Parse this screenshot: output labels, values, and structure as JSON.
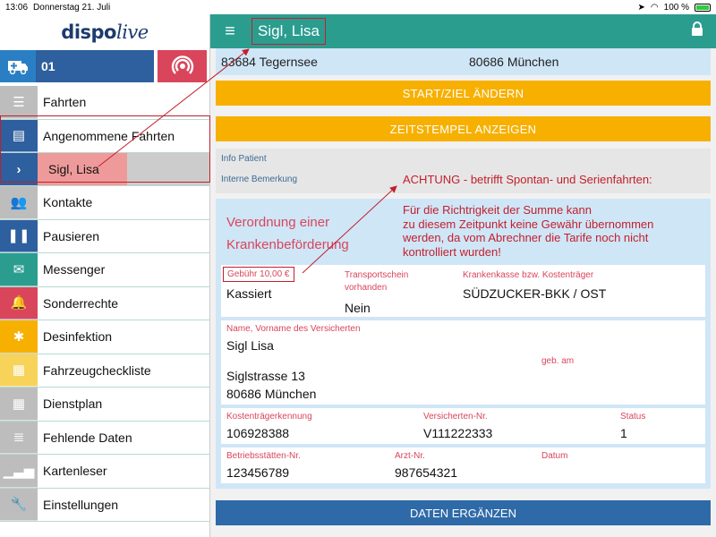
{
  "status": {
    "time": "13:06",
    "date": "Donnerstag 21. Juli",
    "battery": "100 %"
  },
  "sidebar": {
    "logo_main": "dispo",
    "logo_live": "live",
    "vehicle": "01",
    "items": [
      {
        "label": "Fahrten",
        "color": "#bdbdbd",
        "icon": "list-icon",
        "glyph": "☰"
      },
      {
        "label": "Angenommene Fahrten",
        "color": "#2e5f9e",
        "icon": "id-card-icon",
        "glyph": "▤"
      },
      {
        "label": "Kontakte",
        "color": "#bdbdbd",
        "icon": "people-icon",
        "glyph": "👥"
      },
      {
        "label": "Pausieren",
        "color": "#2e5f9e",
        "icon": "pause-icon",
        "glyph": "❚❚"
      },
      {
        "label": "Messenger",
        "color": "#2a9d8f",
        "icon": "envelope-icon",
        "glyph": "✉"
      },
      {
        "label": "Sonderrechte",
        "color": "#d9455b",
        "icon": "bell-icon",
        "glyph": "🔔"
      },
      {
        "label": "Desinfektion",
        "color": "#f7b000",
        "icon": "bug-icon",
        "glyph": "✱"
      },
      {
        "label": "Fahrzeugchecklistе",
        "color": "#f7d35a",
        "icon": "checklist-icon",
        "glyph": "▦"
      },
      {
        "label": "Dienstplan",
        "color": "#bdbdbd",
        "icon": "schedule-icon",
        "glyph": "▦"
      },
      {
        "label": "Fehlende Daten",
        "color": "#bdbdbd",
        "icon": "database-icon",
        "glyph": "≣"
      },
      {
        "label": "Kartenleser",
        "color": "#bdbdbd",
        "icon": "signal-bars-icon",
        "glyph": "▁▃▅"
      },
      {
        "label": "Einstellungen",
        "color": "#bdbdbd",
        "icon": "wrench-icon",
        "glyph": "🔧"
      }
    ],
    "subitem": "Sigl, Lisa"
  },
  "header": {
    "title": "Sigl, Lisa"
  },
  "address": {
    "from": "83684 Tegernsee",
    "to": "80686 München"
  },
  "buttons": {
    "start_ziel": "START/ZIEL ÄNDERN",
    "zeitstempel": "ZEITSTEMPEL ANZEIGEN",
    "daten": "DATEN ERGÄNZEN"
  },
  "info": {
    "patient": "Info Patient",
    "bemerkung": "Interne Bemerkung"
  },
  "warning": {
    "line1": "ACHTUNG - betrifft Spontan- und Serienfahrten:",
    "line2": "Für die Richtrigkeit der Summe kann",
    "line3": "zu diesem Zeitpunkt keine Gewähr übernommen",
    "line4": "werden, da vom Abrechner die Tarife noch nicht",
    "line5": "kontrolliert wurden!"
  },
  "card": {
    "title1": "Verordnung einer",
    "title2": "Krankenbeförderung",
    "fee_label": "Gebühr 10,00 €",
    "fee_value": "Kassiert",
    "transport_label1": "Transportschein",
    "transport_label2": "vorhanden",
    "transport_value": "Nein",
    "kasse_label": "Krankenkasse bzw. Kostenträger",
    "kasse_value": "SÜDZUCKER-BKK / OST",
    "name_label": "Name, Vorname des Versicherten",
    "name_value": "Sigl Lisa",
    "geb_label": "geb. am",
    "street": "Siglstrasse 13",
    "city": "80686 München",
    "kt_label": "Kostenträgerkennung",
    "kt_value": "106928388",
    "vnr_label": "Versicherten-Nr.",
    "vnr_value": "V111222333",
    "status_label": "Status",
    "status_value": "1",
    "bsnr_label": "Betriebsstätten-Nr.",
    "bsnr_value": "123456789",
    "arzt_label": "Arzt-Nr.",
    "arzt_value": "987654321",
    "datum_label": "Datum"
  }
}
